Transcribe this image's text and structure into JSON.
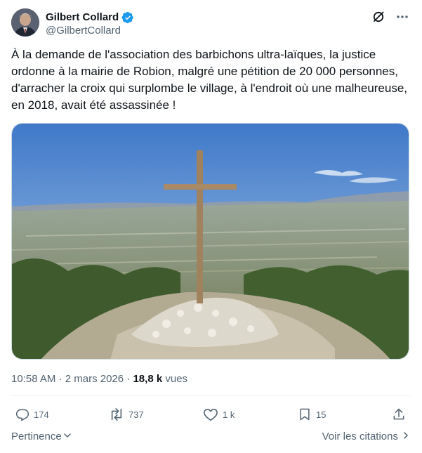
{
  "author": {
    "display_name": "Gilbert Collard",
    "handle": "@GilbertCollard"
  },
  "tweet": {
    "text": "À la demande de l'association des barbichons ultra-laïques, la justice ordonne à la mairie de Robion, malgré une pétition de 20 000 personnes, d'arracher la croix qui surplombe le village, à l'endroit où une malheureuse, en 2018, avait été assassinée !"
  },
  "meta": {
    "time": "10:58 AM",
    "separator": " · ",
    "date": "2 mars 2026",
    "separator2": " · ",
    "views_count": "18,8 k",
    "views_label": " vues"
  },
  "actions": {
    "replies": "174",
    "reposts": "737",
    "likes": "1 k",
    "bookmarks": "15"
  },
  "footer": {
    "sort_label": "Pertinence",
    "quotes_label": "Voir les citations"
  },
  "colors": {
    "verified_blue": "#1d9bf0",
    "secondary_text": "#536471",
    "primary_text": "#0f1419"
  }
}
